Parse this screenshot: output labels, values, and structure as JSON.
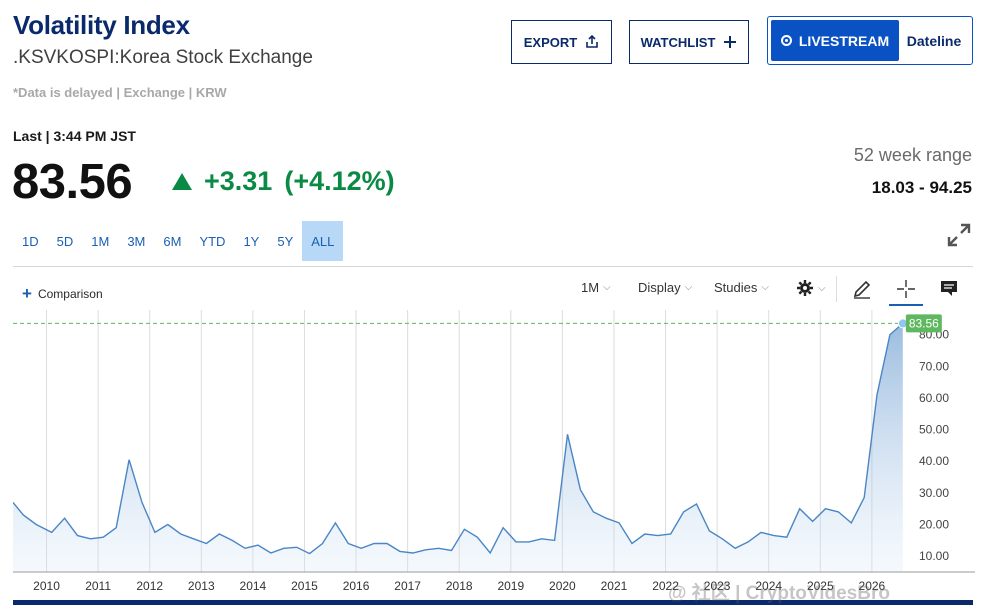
{
  "header": {
    "title": "Volatility Index",
    "exchange": ".KSVKOSPI:Korea Stock Exchange",
    "delay_note": "*Data is delayed | Exchange | KRW"
  },
  "actions": {
    "export_label": "EXPORT",
    "watchlist_label": "WATCHLIST",
    "livestream_label": "LIVESTREAM",
    "dateline_label": "Dateline"
  },
  "quote": {
    "last_label": "Last | 3:44 PM JST",
    "price": "83.56",
    "change": "+3.31",
    "change_pct": "(+4.12%)",
    "direction": "up",
    "range_label": "52 week range",
    "range_value": "18.03 - 94.25"
  },
  "periods": [
    "1D",
    "5D",
    "1M",
    "3M",
    "6M",
    "YTD",
    "1Y",
    "5Y",
    "ALL"
  ],
  "active_period": "ALL",
  "toolbar": {
    "comparison_label": "Comparison",
    "interval_label": "1M",
    "display_label": "Display",
    "studies_label": "Studies"
  },
  "watermark": "@ 社区 | CryptoVidesBro",
  "colors": {
    "navy": "#0a2a6b",
    "blue": "#0a52c4",
    "up_green": "#0a8a45",
    "line": "#4a86c5",
    "last_marker": "#5fb85f"
  },
  "chart_data": {
    "type": "area",
    "x_labels": [
      "2010",
      "2011",
      "2012",
      "2013",
      "2014",
      "2015",
      "2016",
      "2017",
      "2018",
      "2019",
      "2020",
      "2021",
      "2022",
      "2023",
      "2024",
      "2025",
      "2026"
    ],
    "y_ticks": [
      "10.00",
      "20.00",
      "30.00",
      "40.00",
      "50.00",
      "60.00",
      "70.00",
      "80.00"
    ],
    "ylim": [
      5,
      84
    ],
    "xlim": [
      2009.35,
      2026.7
    ],
    "last_value_label": "83.56",
    "grid": "vertical",
    "series": [
      {
        "x": [
          2009.35,
          2009.55,
          2009.8,
          2010.1,
          2010.35,
          2010.6,
          2010.85,
          2011.1,
          2011.35,
          2011.6,
          2011.85,
          2012.1,
          2012.35,
          2012.6,
          2012.85,
          2013.1,
          2013.35,
          2013.6,
          2013.85,
          2014.1,
          2014.35,
          2014.6,
          2014.85,
          2015.1,
          2015.35,
          2015.6,
          2015.85,
          2016.1,
          2016.35,
          2016.6,
          2016.85,
          2017.1,
          2017.35,
          2017.6,
          2017.85,
          2018.1,
          2018.35,
          2018.6,
          2018.85,
          2019.1,
          2019.35,
          2019.6,
          2019.85,
          2020.1,
          2020.35,
          2020.6,
          2020.85,
          2021.1,
          2021.35,
          2021.6,
          2021.85,
          2022.1,
          2022.35,
          2022.6,
          2022.85,
          2023.1,
          2023.35,
          2023.6,
          2023.85,
          2024.1,
          2024.35,
          2024.6,
          2024.85,
          2025.1,
          2025.35,
          2025.6,
          2025.85,
          2026.1,
          2026.35,
          2026.6
        ],
        "y": [
          27,
          23,
          20,
          17.5,
          22,
          16.5,
          15.5,
          16,
          19,
          40.5,
          27,
          17.5,
          20,
          17,
          15.5,
          14,
          17,
          15,
          12.5,
          13.5,
          11,
          12.5,
          12.8,
          10.8,
          14,
          20.5,
          14,
          12.5,
          14,
          14,
          11.5,
          11,
          12,
          12.5,
          11.8,
          18.5,
          16,
          11,
          19,
          14.5,
          14.5,
          15.5,
          15,
          48.5,
          31,
          24,
          22,
          20.5,
          14,
          17,
          16.5,
          17,
          24,
          26.5,
          18,
          15.5,
          12.5,
          14.5,
          17.5,
          16.5,
          16,
          25,
          21,
          25,
          24,
          20.5,
          28.5,
          61,
          80,
          83.56
        ]
      }
    ]
  }
}
